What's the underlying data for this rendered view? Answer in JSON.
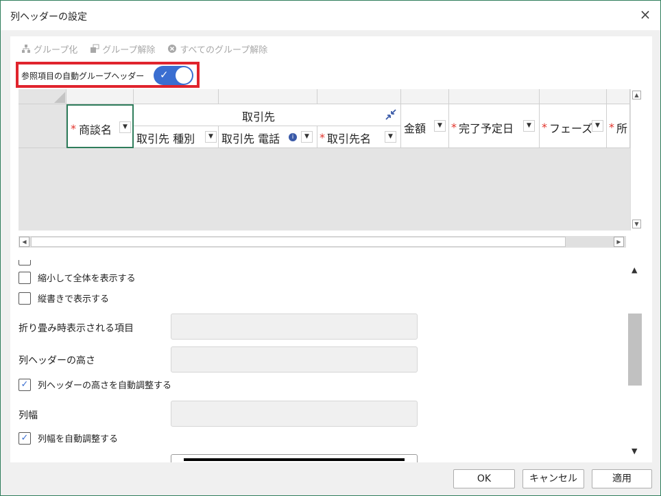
{
  "window": {
    "title": "列ヘッダーの設定",
    "close_icon": "×"
  },
  "toolbar": {
    "group": "グループ化",
    "ungroup": "グループ解除",
    "ungroup_all": "すべてのグループ解除"
  },
  "auto_group": {
    "label": "参照項目の自動グループヘッダー",
    "checked": true,
    "highlight_color": "#e0242d",
    "toggle_color": "#3a6ed1"
  },
  "preview": {
    "group_header": "取引先",
    "columns": {
      "deal_name": "商談名",
      "account_type": "取引先 種別",
      "account_phone": "取引先 電話",
      "account_name": "取引先名",
      "amount": "金額",
      "close_date": "完了予定日",
      "phase": "フェーズ",
      "owner_partial": "所"
    },
    "required_mark": "*",
    "selected_border_color": "#2e7d5b"
  },
  "settings": {
    "shrink_to_fit": "縮小して全体を表示する",
    "vertical_text": "縦書きで表示する",
    "collapsed_item_label": "折り畳み時表示される項目",
    "header_height_label": "列ヘッダーの高さ",
    "auto_header_height": "列ヘッダーの高さを自動調整する",
    "column_width_label": "列幅",
    "auto_column_width": "列幅を自動調整する"
  },
  "footer": {
    "ok": "OK",
    "cancel": "キャンセル",
    "apply": "適用"
  }
}
